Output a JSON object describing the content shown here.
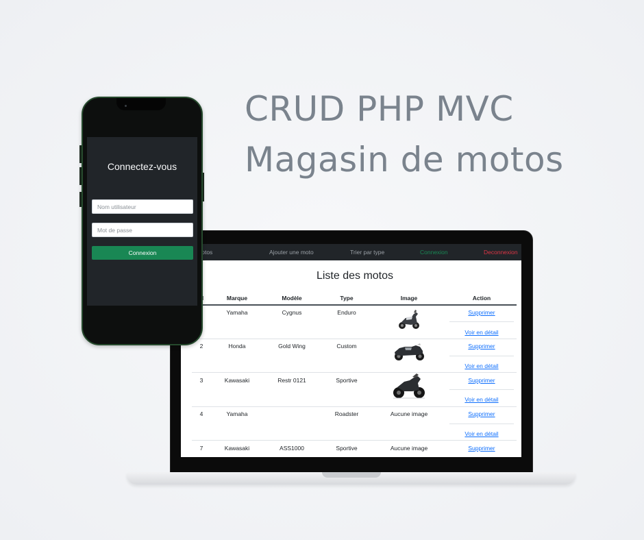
{
  "headline": {
    "line1": "CRUD PHP MVC",
    "line2": "Magasin de motos"
  },
  "navbar": {
    "items": [
      {
        "label": "e des motos"
      },
      {
        "label": "Ajouter une moto"
      },
      {
        "label": "Trier par type"
      },
      {
        "label": "Connexion",
        "color": "#198754"
      },
      {
        "label": "Deconnexion",
        "color": "#dc3545"
      }
    ]
  },
  "page_title": "Liste des motos",
  "table": {
    "headers": [
      "d",
      "Marque",
      "Modèle",
      "Type",
      "Image",
      "Action"
    ],
    "rows": [
      {
        "id": "",
        "marque": "Yamaha",
        "modele": "Cygnus",
        "type": "Enduro",
        "image": "scooter-image",
        "delete": "Supprimer",
        "detail": "Voir en détail"
      },
      {
        "id": "2",
        "marque": "Honda",
        "modele": "Gold Wing",
        "type": "Custom",
        "image": "touring-bike-image",
        "delete": "Supprimer",
        "detail": "Voir en détail"
      },
      {
        "id": "3",
        "marque": "Kawasaki",
        "modele": "Restr 0121",
        "type": "Sportive",
        "image": "naked-bike-image",
        "delete": "Supprimer",
        "detail": "Voir en détail"
      },
      {
        "id": "4",
        "marque": "Yamaha",
        "modele": "",
        "type": "Roadster",
        "image_text": "Aucune image",
        "delete": "Supprimer",
        "detail": "Voir en détail"
      },
      {
        "id": "7",
        "marque": "Kawasaki",
        "modele": "ASS1000",
        "type": "Sportive",
        "image_text": "Aucune image",
        "delete": "Supprimer"
      }
    ]
  },
  "login": {
    "title": "Connectez-vous",
    "username_placeholder": "Nom utilisateur",
    "password_placeholder": "Mot de passe",
    "submit_label": "Connexion",
    "accent": "#198754"
  }
}
